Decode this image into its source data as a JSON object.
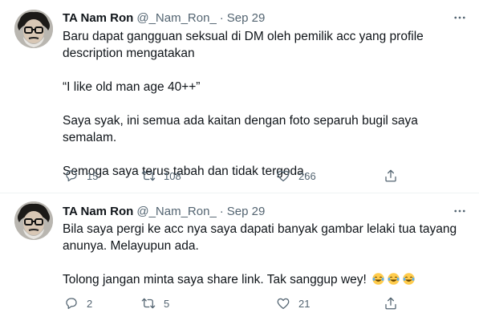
{
  "tweets": [
    {
      "name": "TA Nam Ron",
      "handle": "@_Nam_Ron_",
      "separator": "·",
      "time": "Sep 29",
      "paragraphs": [
        "Baru dapat gangguan seksual di DM oleh pemilik acc yang profile\ndescription mengatakan",
        "“I like old man age 40++”",
        "Saya syak, ini semua ada kaitan dengan foto separuh bugil saya semalam.",
        "Semoga saya terus tabah dan tidak tergoda."
      ],
      "emoji_suffix": "",
      "reply_count": "15",
      "retweet_count": "108",
      "like_count": "266"
    },
    {
      "name": "TA Nam Ron",
      "handle": "@_Nam_Ron_",
      "separator": "·",
      "time": "Sep 29",
      "paragraphs": [
        "Bila saya pergi ke acc nya saya dapati banyak gambar lelaki tua tayang\nanunya. Melayupun ada.",
        "Tolong jangan minta saya share link. Tak sanggup wey!"
      ],
      "emoji_suffix": "😂😂😂",
      "reply_count": "2",
      "retweet_count": "5",
      "like_count": "21"
    }
  ],
  "icons": {
    "more": "more-horizontal-icon",
    "reply": "reply-icon",
    "retweet": "retweet-icon",
    "like": "heart-icon",
    "share": "share-icon",
    "emoji": "face-with-tears-of-joy-icon"
  },
  "colors": {
    "text": "#0f1419",
    "secondary": "#536471",
    "divider": "#eff3f4",
    "emoji_face": "#ffcc4d"
  }
}
